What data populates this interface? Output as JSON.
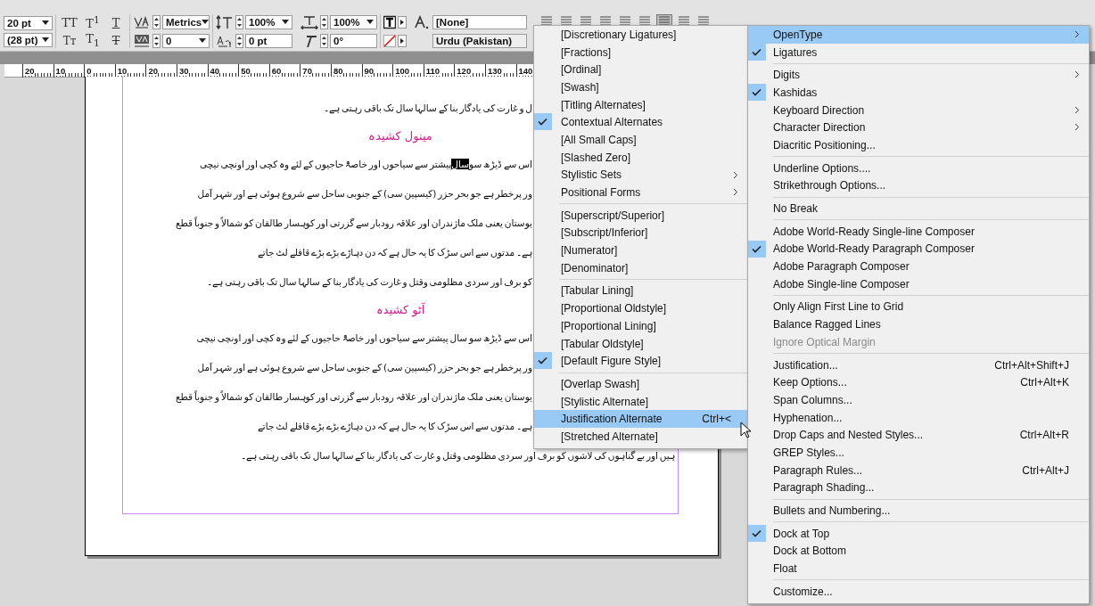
{
  "toolbar": {
    "font_size": "20 pt",
    "leading": "(28 pt)",
    "kerning": "Metrics",
    "tracking": "0",
    "vertical_scale": "100%",
    "horizontal_scale": "100%",
    "baseline_shift": "0 pt",
    "skew": "0°",
    "character_style": "[None]",
    "language": "Urdu (Pakistan)",
    "case_buttons": [
      {
        "kind": "caps",
        "label": "TT"
      },
      {
        "kind": "superscript",
        "label": "T$^{1}$"
      },
      {
        "kind": "underline",
        "label": "T"
      },
      {
        "kind": "small_caps",
        "label": "Tт"
      },
      {
        "kind": "subscript",
        "label": "T$_{1}$"
      },
      {
        "kind": "strike",
        "label": "T"
      }
    ],
    "alignment": [
      {
        "selected": false
      },
      {
        "selected": false
      },
      {
        "selected": false
      },
      {
        "selected": false
      },
      {
        "selected": false
      },
      {
        "selected": false
      },
      {
        "selected": true
      },
      {
        "selected": false
      },
      {
        "selected": false
      }
    ]
  },
  "ruler": {
    "labels": [
      "20",
      "10",
      "0",
      "10",
      "20",
      "30",
      "40",
      "50",
      "60",
      "70",
      "80",
      "90",
      "100",
      "110",
      "120",
      "130",
      "140"
    ]
  },
  "document": {
    "blocks": [
      {
        "kind": "line",
        "parts": [
          {
            "text": "ل و غارت کی یادگار بنا کے سالہا سال تک باقی رہتی ہے۔",
            "selected": false
          }
        ]
      },
      {
        "kind": "heading",
        "text": "مینول کشیدہ"
      },
      {
        "kind": "line",
        "parts": [
          {
            "text": "اس سے ڈیڑھ سو",
            "selected": false
          },
          {
            "text": "سال",
            "selected": true
          },
          {
            "text": " پیشتر سے سیاحوں اور خاصۃً حاجیوں کے لئے وہ کچی اور اونچی نیچی",
            "selected": false
          }
        ]
      },
      {
        "kind": "line",
        "parts": [
          {
            "text": "ور پرخطر ہے جو بحر حزر (کیسپین سی) کے جنوبی ساحل سے شروع ہوئی ہے اور شہر آمل",
            "selected": false
          }
        ]
      },
      {
        "kind": "line",
        "parts": [
          {
            "text": "یوستان یعنی ملک ماژندران اور علاقہ رودبار سے گزرتی اور کوہسار طالقان کو شمالاً و جنوباً قطع",
            "selected": false
          }
        ]
      },
      {
        "kind": "line",
        "parts": [
          {
            "text": "ہے۔ مدتوں سے اس سڑک کا یہ حال ہے کہ دن دہاڑے بڑے بڑے قافلے لٹ جاتے",
            "selected": false
          }
        ]
      },
      {
        "kind": "line",
        "parts": [
          {
            "text": "کو برف اور سردی مظلومی وقتل و غارت کی یادگار بنا کے سالہا سال تک باقی رہتی ہے۔",
            "selected": false
          }
        ]
      },
      {
        "kind": "heading",
        "text": "آٹو کشیدہ"
      },
      {
        "kind": "line",
        "parts": [
          {
            "text": "اس سے ڈیڑھ سو سال پیشتر سے سیاحوں اور خاصۃً حاجیوں کے لئے وہ کچی اور اونچی نیچی",
            "selected": false
          }
        ]
      },
      {
        "kind": "line",
        "parts": [
          {
            "text": "ور پرخطر ہے جو بحر حزر (کیسپین سی) کے جنوبی ساحل سے شروع ہوئی ہے اور شہر آمل",
            "selected": false
          }
        ]
      },
      {
        "kind": "line",
        "parts": [
          {
            "text": "یوستان یعنی ملک ماژندران اور علاقہ رودبار سے گزرتی اور کوہسار طالقان کو شمالاً و جنوباً قطع",
            "selected": false
          }
        ]
      },
      {
        "kind": "line",
        "parts": [
          {
            "text": "ہے۔ مدتوں سے اس سڑک کا یہ حال ہے کہ دن دہاڑے بڑے بڑے قافلے لٹ جاتے",
            "selected": false
          }
        ]
      },
      {
        "kind": "full_line",
        "parts": [
          {
            "text": "ہیں اور بے گناہوں کی لاشوں کو برف اور سردی مظلومی وقتل و غارت کی یادگار بنا کے سالہا سال تک باقی رہتی ہے۔",
            "selected": false
          }
        ]
      }
    ]
  },
  "opentype_menu": {
    "items": [
      {
        "kind": "item",
        "label": "[Discretionary Ligatures]",
        "checked": false,
        "selected": false,
        "submenu": false
      },
      {
        "kind": "item",
        "label": "[Fractions]",
        "checked": false,
        "selected": false,
        "submenu": false
      },
      {
        "kind": "item",
        "label": "[Ordinal]",
        "checked": false,
        "selected": false,
        "submenu": false
      },
      {
        "kind": "item",
        "label": "[Swash]",
        "checked": false,
        "selected": false,
        "submenu": false
      },
      {
        "kind": "item",
        "label": "[Titling Alternates]",
        "checked": false,
        "selected": false,
        "submenu": false
      },
      {
        "kind": "item",
        "label": "Contextual Alternates",
        "checked": true,
        "selected": false,
        "submenu": false
      },
      {
        "kind": "item",
        "label": "[All Small Caps]",
        "checked": false,
        "selected": false,
        "submenu": false
      },
      {
        "kind": "item",
        "label": "[Slashed Zero]",
        "checked": false,
        "selected": false,
        "submenu": false
      },
      {
        "kind": "item",
        "label": "Stylistic Sets",
        "checked": false,
        "selected": false,
        "submenu": true
      },
      {
        "kind": "item",
        "label": "Positional Forms",
        "checked": false,
        "selected": false,
        "submenu": true
      },
      {
        "kind": "separator"
      },
      {
        "kind": "item",
        "label": "[Superscript/Superior]",
        "checked": false,
        "selected": false,
        "submenu": false
      },
      {
        "kind": "item",
        "label": "[Subscript/Inferior]",
        "checked": false,
        "selected": false,
        "submenu": false
      },
      {
        "kind": "item",
        "label": "[Numerator]",
        "checked": false,
        "selected": false,
        "submenu": false
      },
      {
        "kind": "item",
        "label": "[Denominator]",
        "checked": false,
        "selected": false,
        "submenu": false
      },
      {
        "kind": "separator"
      },
      {
        "kind": "item",
        "label": "[Tabular Lining]",
        "checked": false,
        "selected": false,
        "submenu": false
      },
      {
        "kind": "item",
        "label": "[Proportional Oldstyle]",
        "checked": false,
        "selected": false,
        "submenu": false
      },
      {
        "kind": "item",
        "label": "[Proportional Lining]",
        "checked": false,
        "selected": false,
        "submenu": false
      },
      {
        "kind": "item",
        "label": "[Tabular Oldstyle]",
        "checked": false,
        "selected": false,
        "submenu": false
      },
      {
        "kind": "item",
        "label": "[Default Figure Style]",
        "checked": true,
        "selected": false,
        "submenu": false
      },
      {
        "kind": "separator"
      },
      {
        "kind": "item",
        "label": "[Overlap Swash]",
        "checked": false,
        "selected": false,
        "submenu": false
      },
      {
        "kind": "item",
        "label": "[Stylistic Alternate]",
        "checked": false,
        "selected": false,
        "submenu": false
      },
      {
        "kind": "item",
        "label": "Justification Alternate",
        "checked": false,
        "selected": true,
        "submenu": false,
        "shortcut": "Ctrl+<"
      },
      {
        "kind": "item",
        "label": "[Stretched Alternate]",
        "checked": false,
        "selected": false,
        "submenu": false
      }
    ]
  },
  "panel_menu": {
    "items": [
      {
        "kind": "item",
        "label": "OpenType",
        "checked": false,
        "selected": true,
        "submenu": true
      },
      {
        "kind": "item",
        "label": "Ligatures",
        "checked": true,
        "selected": false,
        "submenu": false
      },
      {
        "kind": "separator"
      },
      {
        "kind": "item",
        "label": "Digits",
        "checked": false,
        "selected": false,
        "submenu": true
      },
      {
        "kind": "item",
        "label": "Kashidas",
        "checked": true,
        "selected": false,
        "submenu": false
      },
      {
        "kind": "item",
        "label": "Keyboard Direction",
        "checked": false,
        "selected": false,
        "submenu": true
      },
      {
        "kind": "item",
        "label": "Character Direction",
        "checked": false,
        "selected": false,
        "submenu": true
      },
      {
        "kind": "item",
        "label": "Diacritic Positioning...",
        "checked": false,
        "selected": false,
        "submenu": false
      },
      {
        "kind": "separator"
      },
      {
        "kind": "item",
        "label": "Underline Options....",
        "checked": false,
        "selected": false,
        "submenu": false
      },
      {
        "kind": "item",
        "label": "Strikethrough Options...",
        "checked": false,
        "selected": false,
        "submenu": false
      },
      {
        "kind": "separator"
      },
      {
        "kind": "item",
        "label": "No Break",
        "checked": false,
        "selected": false,
        "submenu": false
      },
      {
        "kind": "separator"
      },
      {
        "kind": "item",
        "label": "Adobe World-Ready Single-line Composer",
        "checked": false,
        "selected": false,
        "submenu": false
      },
      {
        "kind": "item",
        "label": "Adobe World-Ready Paragraph Composer",
        "checked": true,
        "selected": false,
        "submenu": false
      },
      {
        "kind": "item",
        "label": "Adobe Paragraph Composer",
        "checked": false,
        "selected": false,
        "submenu": false
      },
      {
        "kind": "item",
        "label": "Adobe Single-line Composer",
        "checked": false,
        "selected": false,
        "submenu": false
      },
      {
        "kind": "separator"
      },
      {
        "kind": "item",
        "label": "Only Align First Line to Grid",
        "checked": false,
        "selected": false,
        "submenu": false
      },
      {
        "kind": "item",
        "label": "Balance Ragged Lines",
        "checked": false,
        "selected": false,
        "submenu": false
      },
      {
        "kind": "item",
        "label": "Ignore Optical Margin",
        "checked": false,
        "selected": false,
        "submenu": false,
        "disabled": true
      },
      {
        "kind": "separator"
      },
      {
        "kind": "item",
        "label": "Justification...",
        "checked": false,
        "selected": false,
        "submenu": false,
        "shortcut": "Ctrl+Alt+Shift+J"
      },
      {
        "kind": "item",
        "label": "Keep Options...",
        "checked": false,
        "selected": false,
        "submenu": false,
        "shortcut": "Ctrl+Alt+K"
      },
      {
        "kind": "item",
        "label": "Span Columns...",
        "checked": false,
        "selected": false,
        "submenu": false
      },
      {
        "kind": "item",
        "label": "Hyphenation...",
        "checked": false,
        "selected": false,
        "submenu": false
      },
      {
        "kind": "item",
        "label": "Drop Caps and Nested Styles...",
        "checked": false,
        "selected": false,
        "submenu": false,
        "shortcut": "Ctrl+Alt+R"
      },
      {
        "kind": "item",
        "label": "GREP Styles...",
        "checked": false,
        "selected": false,
        "submenu": false
      },
      {
        "kind": "item",
        "label": "Paragraph Rules...",
        "checked": false,
        "selected": false,
        "submenu": false,
        "shortcut": "Ctrl+Alt+J"
      },
      {
        "kind": "item",
        "label": "Paragraph Shading...",
        "checked": false,
        "selected": false,
        "submenu": false
      },
      {
        "kind": "separator"
      },
      {
        "kind": "item",
        "label": "Bullets and Numbering...",
        "checked": false,
        "selected": false,
        "submenu": false
      },
      {
        "kind": "separator"
      },
      {
        "kind": "item",
        "label": "Dock at Top",
        "checked": true,
        "selected": false,
        "submenu": false
      },
      {
        "kind": "item",
        "label": "Dock at Bottom",
        "checked": false,
        "selected": false,
        "submenu": false
      },
      {
        "kind": "item",
        "label": "Float",
        "checked": false,
        "selected": false,
        "submenu": false
      },
      {
        "kind": "separator"
      },
      {
        "kind": "item",
        "label": "Customize...",
        "checked": false,
        "selected": false,
        "submenu": false
      }
    ]
  }
}
